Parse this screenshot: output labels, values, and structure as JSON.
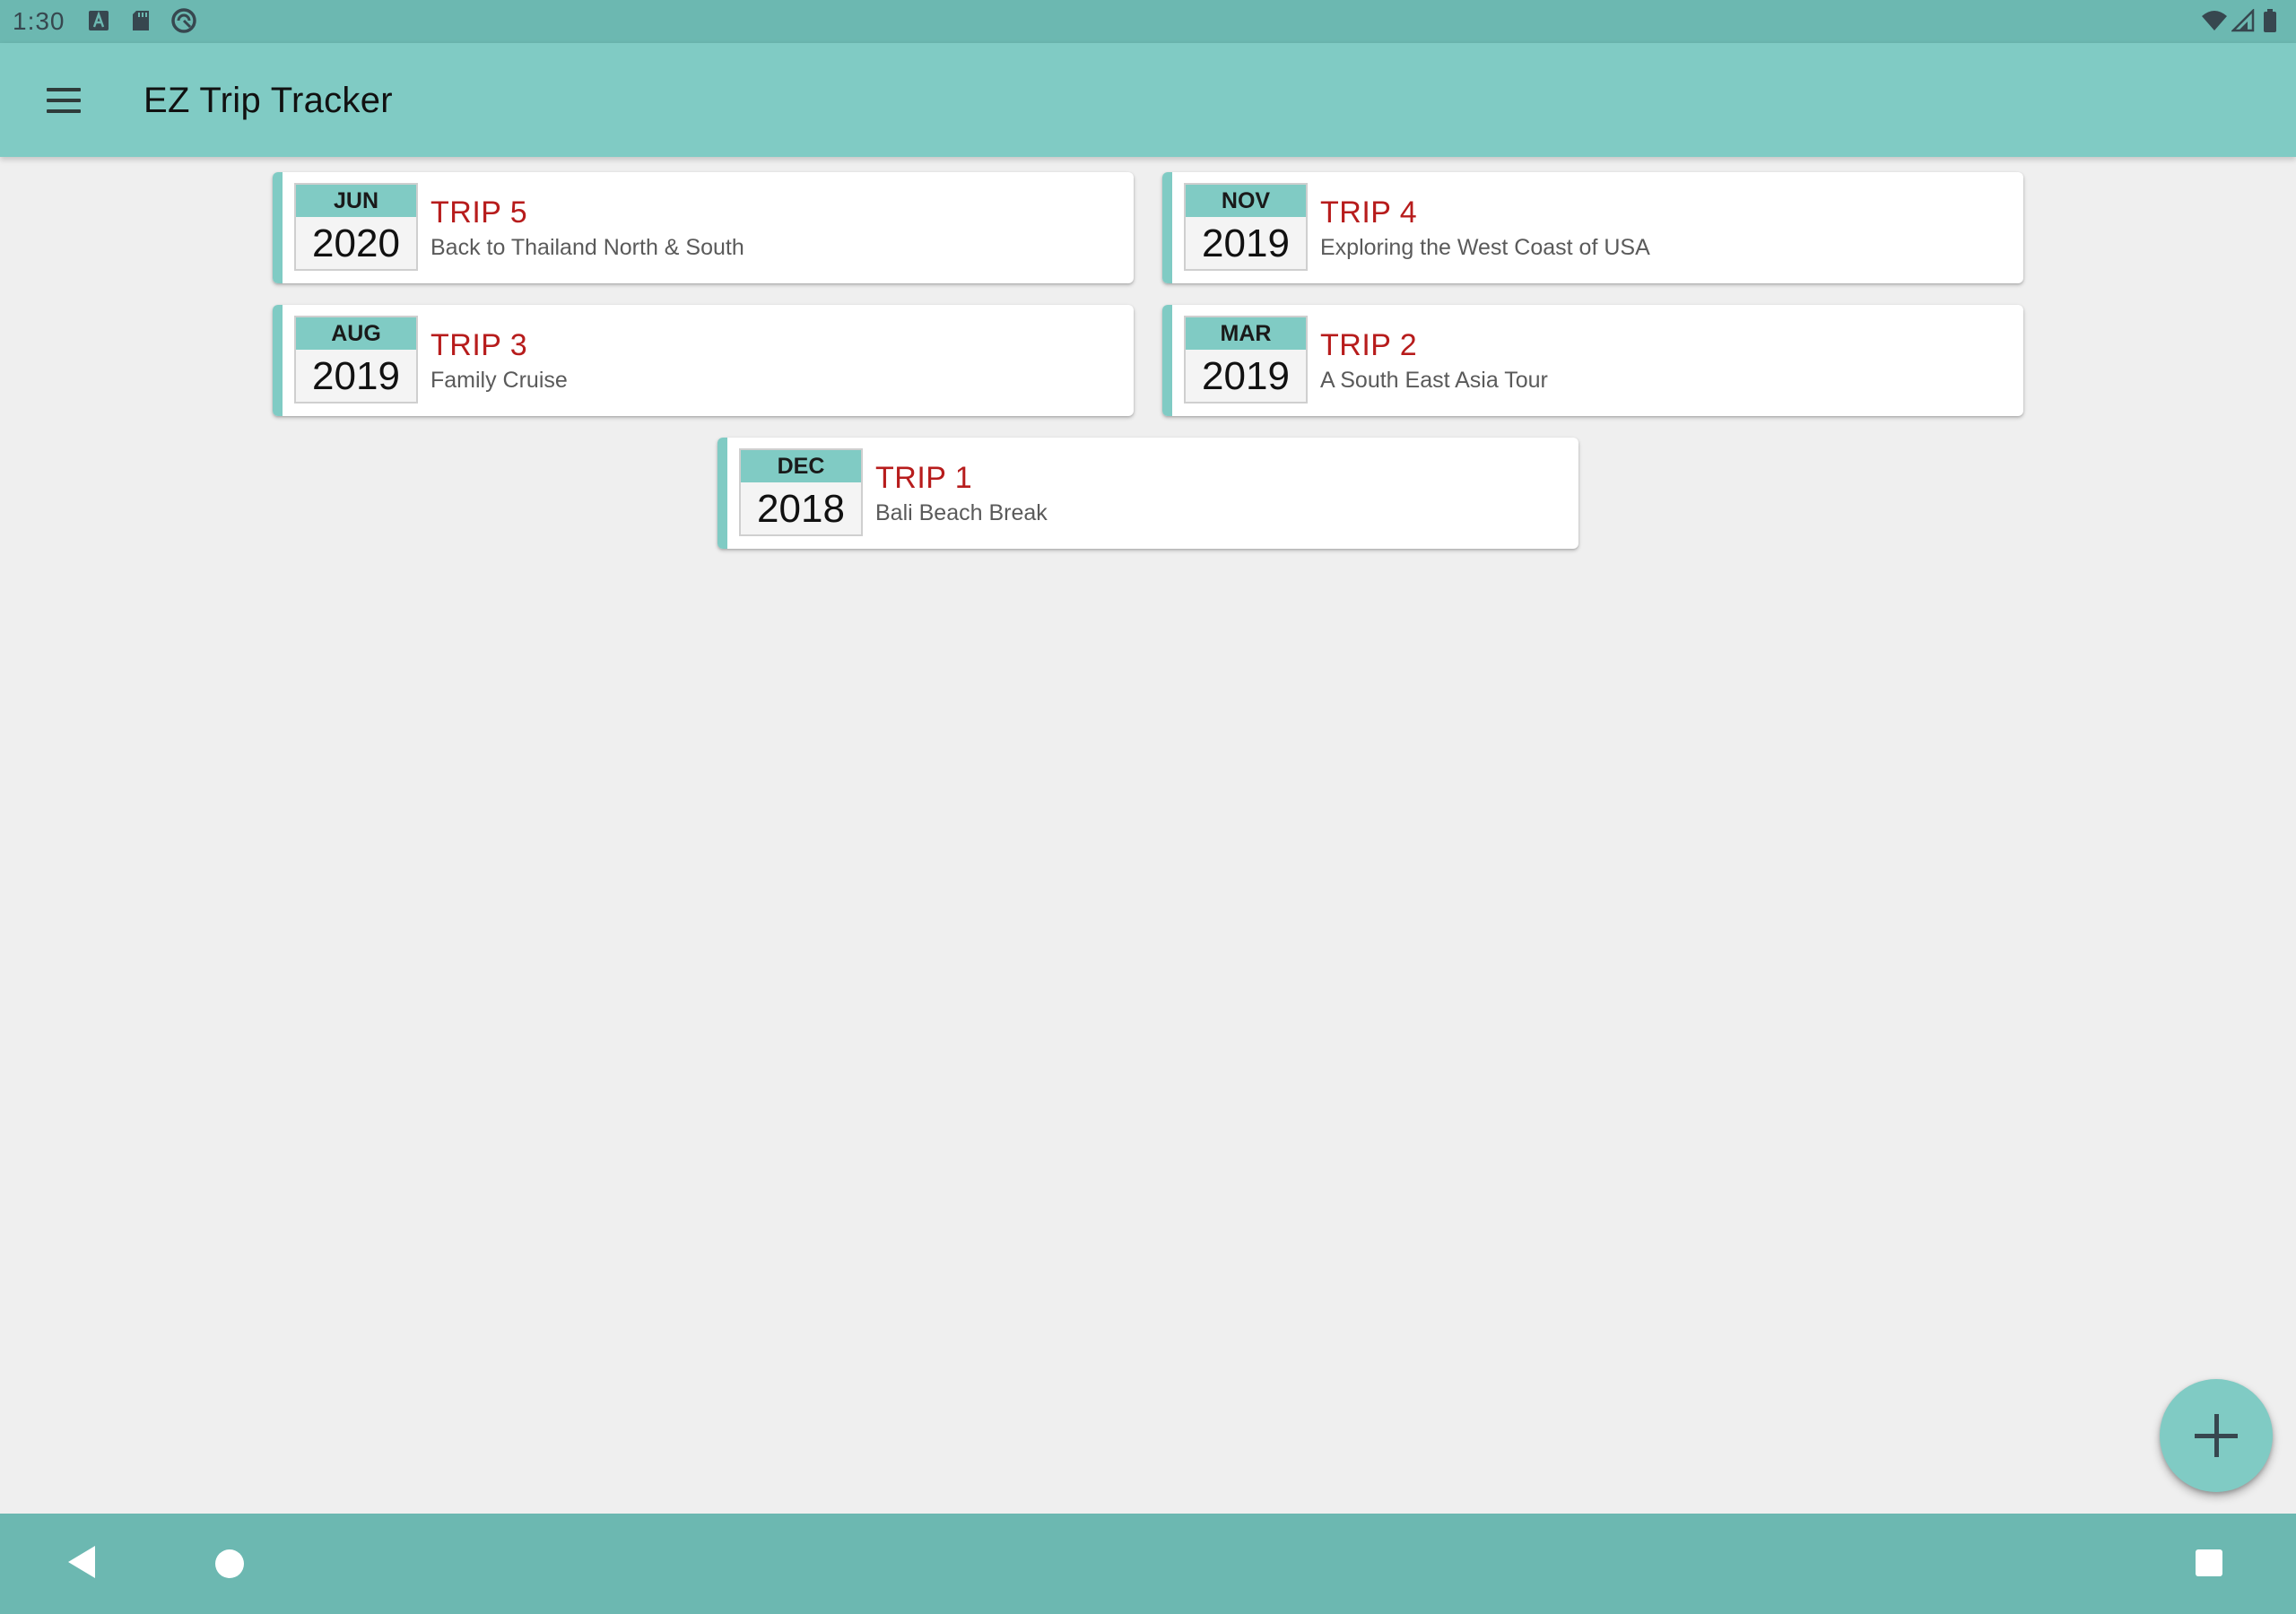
{
  "status_bar": {
    "time": "1:30",
    "left_icons": [
      "font-a-icon",
      "sd-card-icon",
      "sync-circle-icon"
    ],
    "right_icons": [
      "wifi-icon",
      "signal-icon",
      "battery-icon"
    ]
  },
  "app_bar": {
    "title": "EZ Trip Tracker",
    "menu_icon": "hamburger-menu-icon"
  },
  "trips": [
    {
      "month": "JUN",
      "year": "2020",
      "name": "TRIP 5",
      "description": "Back to Thailand North & South"
    },
    {
      "month": "NOV",
      "year": "2019",
      "name": "TRIP 4",
      "description": "Exploring the West Coast of USA"
    },
    {
      "month": "AUG",
      "year": "2019",
      "name": "TRIP 3",
      "description": "Family Cruise"
    },
    {
      "month": "MAR",
      "year": "2019",
      "name": "TRIP 2",
      "description": "A South East Asia Tour"
    },
    {
      "month": "DEC",
      "year": "2018",
      "name": "TRIP 1",
      "description": "Bali Beach Break"
    }
  ],
  "fab": {
    "icon": "plus-icon"
  },
  "nav_bar": {
    "icons": [
      "back-icon",
      "home-icon",
      "recents-icon"
    ]
  },
  "colors": {
    "primary": "#80cbc4",
    "primary_dark": "#6cb8b1",
    "trip_name": "#b71c1c",
    "background": "#efefef"
  }
}
